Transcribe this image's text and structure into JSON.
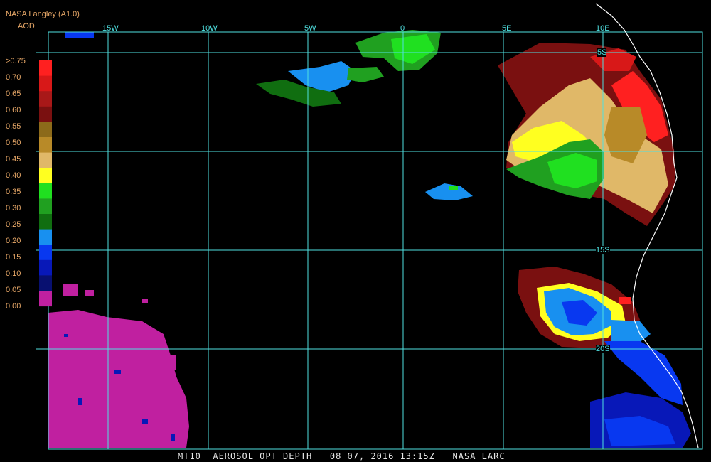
{
  "header": {
    "org": "NASA Langley (A1.0)",
    "product": "AOD"
  },
  "legend": {
    "labels": [
      ">0.75",
      "0.70",
      "0.65",
      "0.60",
      "0.55",
      "0.50",
      "0.45",
      "0.40",
      "0.35",
      "0.30",
      "0.25",
      "0.20",
      "0.15",
      "0.10",
      "0.05",
      "0.00"
    ],
    "colors": [
      "#ff2020",
      "#d81818",
      "#a81818",
      "#7a1010",
      "#8c6a1a",
      "#b88a28",
      "#e0b868",
      "#ffff20",
      "#20e020",
      "#20a020",
      "#106e10",
      "#1890f0",
      "#0838f0",
      "#0818b8",
      "#081070",
      "#c020a0"
    ]
  },
  "grid": {
    "lon_labels": [
      "15W",
      "10W",
      "5W",
      "0",
      "5E",
      "10E"
    ],
    "lat_labels": [
      "5S",
      "15S",
      "20S"
    ]
  },
  "colors": {
    "grid": "#4fe0e0",
    "coast": "#ffffff",
    "low_aod": "#c020a0"
  },
  "caption": "MT10  AEROSOL OPT DEPTH   08 07, 2016 13:15Z   NASA LARC"
}
